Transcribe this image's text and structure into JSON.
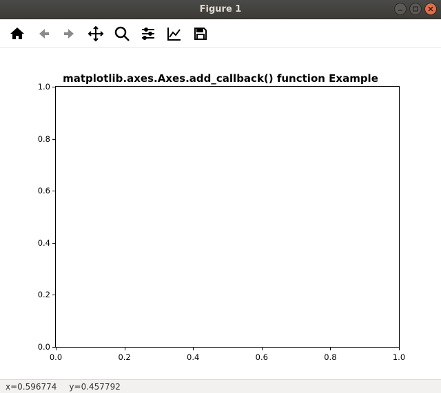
{
  "window": {
    "title": "Figure 1"
  },
  "toolbar": {
    "home": "Home",
    "back": "Back",
    "forward": "Forward",
    "pan": "Pan",
    "zoom": "Zoom",
    "subplots": "Configure subplots",
    "axes": "Edit axis",
    "save": "Save"
  },
  "chart_data": {
    "type": "line",
    "title": "matplotlib.axes.Axes.add_callback() function Example",
    "xlabel": "",
    "ylabel": "",
    "xlim": [
      0.0,
      1.0
    ],
    "ylim": [
      0.0,
      1.0
    ],
    "xticks": [
      "0.0",
      "0.2",
      "0.4",
      "0.6",
      "0.8",
      "1.0"
    ],
    "yticks": [
      "0.0",
      "0.2",
      "0.4",
      "0.6",
      "0.8",
      "1.0"
    ],
    "series": []
  },
  "status": {
    "x_label": "x=0.596774",
    "y_label": "y=0.457792"
  }
}
